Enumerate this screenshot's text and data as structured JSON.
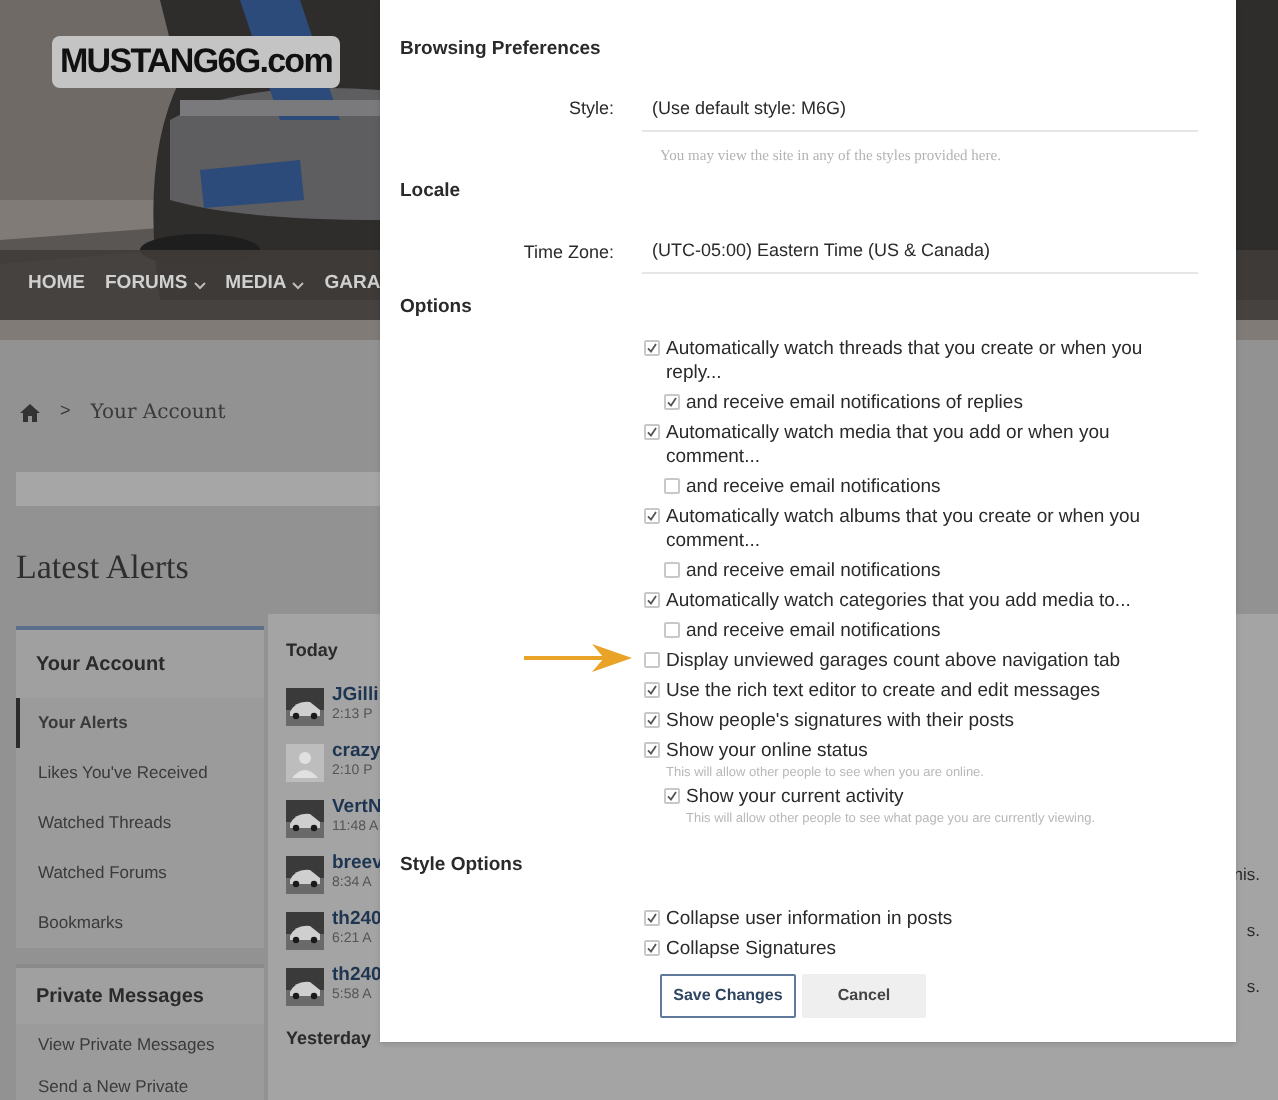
{
  "header": {
    "logo": "MUSTANG6G.com",
    "nav": [
      {
        "label": "HOME",
        "dropdown": false
      },
      {
        "label": "FORUMS",
        "dropdown": true
      },
      {
        "label": "MEDIA",
        "dropdown": true
      },
      {
        "label": "GARA",
        "dropdown": false
      }
    ]
  },
  "breadcrumb": {
    "separator": ">",
    "items": [
      "Your Account"
    ]
  },
  "page_title": "Latest Alerts",
  "sidebar": [
    {
      "title": "Your Account",
      "items": [
        {
          "label": "Your Alerts",
          "selected": true
        },
        {
          "label": "Likes You've Received",
          "selected": false
        },
        {
          "label": "Watched Threads",
          "selected": false
        },
        {
          "label": "Watched Forums",
          "selected": false
        },
        {
          "label": "Bookmarks",
          "selected": false
        }
      ]
    },
    {
      "title": "Private Messages",
      "items": [
        {
          "label": "View Private Messages",
          "selected": false
        },
        {
          "label": "Send a New Private",
          "selected": false
        }
      ]
    }
  ],
  "alerts": {
    "groups": [
      {
        "title": "Today",
        "items": [
          {
            "user": "JGilli",
            "time": "2:13 P"
          },
          {
            "user": "crazy",
            "time": "2:10 P",
            "kind": "placeholder"
          },
          {
            "user": "VertN",
            "time": "11:48 A"
          },
          {
            "user": "breev",
            "time": "8:34 A",
            "text_end": "nis."
          },
          {
            "user": "th240",
            "time": "6:21 A",
            "text_end": "s."
          },
          {
            "user": "th240",
            "time": "5:58 A",
            "text_end": "s."
          }
        ]
      },
      {
        "title": "Yesterday"
      }
    ]
  },
  "dialog": {
    "sections": [
      {
        "title": "Browsing Preferences",
        "fields": [
          {
            "label": "Style:",
            "value": "(Use default style: M6G)",
            "hint": "You may view the site in any of the styles provided here."
          }
        ]
      },
      {
        "title": "Locale",
        "fields": [
          {
            "label": "Time Zone:",
            "value": "(UTC-05:00) Eastern Time (US & Canada)"
          }
        ]
      },
      {
        "title": "Options",
        "options": [
          {
            "label": "Automatically watch threads that you create or when you reply...",
            "checked": true,
            "children": [
              {
                "label": "and receive email notifications of replies",
                "checked": true
              }
            ]
          },
          {
            "label": "Automatically watch media that you add or when you comment...",
            "checked": true,
            "children": [
              {
                "label": "and receive email notifications",
                "checked": false
              }
            ]
          },
          {
            "label": "Automatically watch albums that you create or when you comment...",
            "checked": true,
            "children": [
              {
                "label": "and receive email notifications",
                "checked": false
              }
            ]
          },
          {
            "label": "Automatically watch categories that you add media to...",
            "checked": true,
            "children": [
              {
                "label": "and receive email notifications",
                "checked": false
              }
            ]
          },
          {
            "label": "Display unviewed garages count above navigation tab",
            "checked": false,
            "annotated": true
          },
          {
            "label": "Use the rich text editor to create and edit messages",
            "checked": true
          },
          {
            "label": "Show people's signatures with their posts",
            "checked": true
          },
          {
            "label": "Show your online status",
            "checked": true,
            "hint": "This will allow other people to see when you are online.",
            "children": [
              {
                "label": "Show your current activity",
                "checked": true,
                "hint": "This will allow other people to see what page you are currently viewing."
              }
            ]
          }
        ]
      },
      {
        "title": "Style Options",
        "options": [
          {
            "label": "Collapse user information in posts",
            "checked": true
          },
          {
            "label": "Collapse Signatures",
            "checked": true
          }
        ]
      }
    ],
    "buttons": [
      {
        "label": "Save Changes",
        "kind": "primary"
      },
      {
        "label": "Cancel",
        "kind": "secondary"
      }
    ]
  }
}
